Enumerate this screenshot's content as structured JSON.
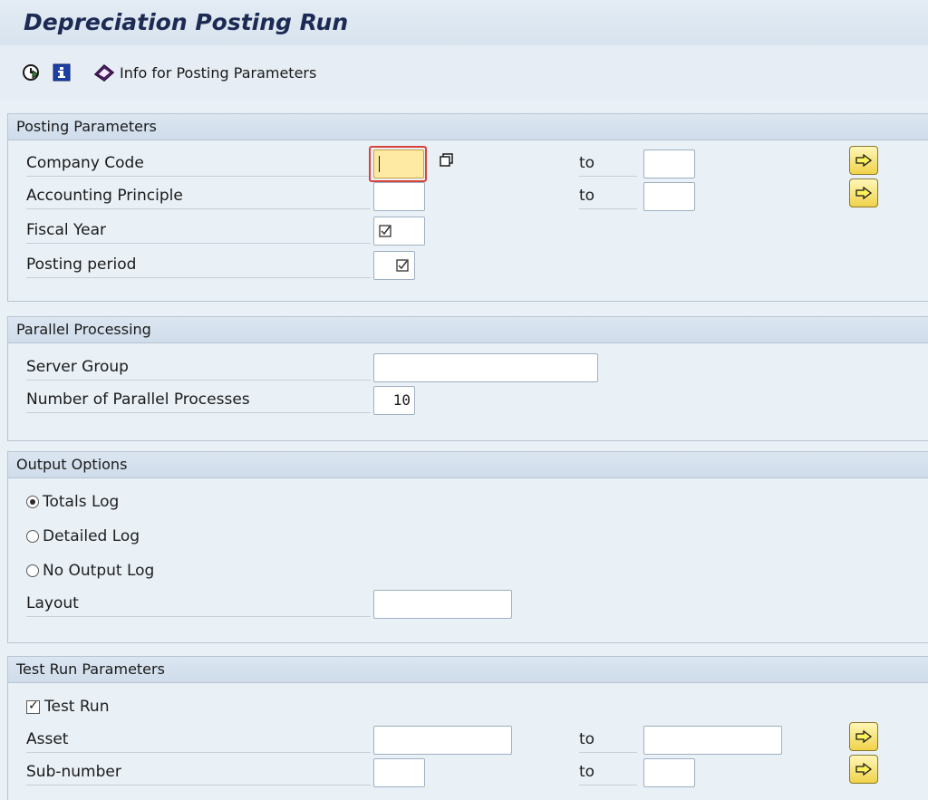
{
  "title": "Depreciation Posting Run",
  "toolbar": {
    "execute_icon": "execute-clock-icon",
    "info_icon": "info-icon",
    "info_params_label": "Info for Posting Parameters"
  },
  "posting_parameters": {
    "header": "Posting Parameters",
    "company_code_label": "Company Code",
    "company_code_value": "",
    "company_code_to_label": "to",
    "company_code_to_value": "",
    "accounting_principle_label": "Accounting Principle",
    "accounting_principle_value": "",
    "accounting_principle_to_label": "to",
    "accounting_principle_to_value": "",
    "fiscal_year_label": "Fiscal Year",
    "fiscal_year_value": "",
    "posting_period_label": "Posting period",
    "posting_period_value": ""
  },
  "parallel_processing": {
    "header": "Parallel Processing",
    "server_group_label": "Server Group",
    "server_group_value": "",
    "num_processes_label": "Number of Parallel Processes",
    "num_processes_value": "10"
  },
  "output_options": {
    "header": "Output Options",
    "radio_totals": "Totals Log",
    "radio_detailed": "Detailed Log",
    "radio_none": "No Output Log",
    "selected": "Totals Log",
    "layout_label": "Layout",
    "layout_value": ""
  },
  "test_run": {
    "header": "Test Run Parameters",
    "test_run_label": "Test Run",
    "test_run_checked": true,
    "asset_label": "Asset",
    "asset_value": "",
    "asset_to_label": "to",
    "asset_to_value": "",
    "subnumber_label": "Sub-number",
    "subnumber_value": "",
    "subnumber_to_label": "to",
    "subnumber_to_value": ""
  },
  "colors": {
    "background": "#e9f0f6",
    "title": "#1c2a54",
    "focus_field": "#ffeaa3",
    "select_button": "#f0d24a"
  }
}
